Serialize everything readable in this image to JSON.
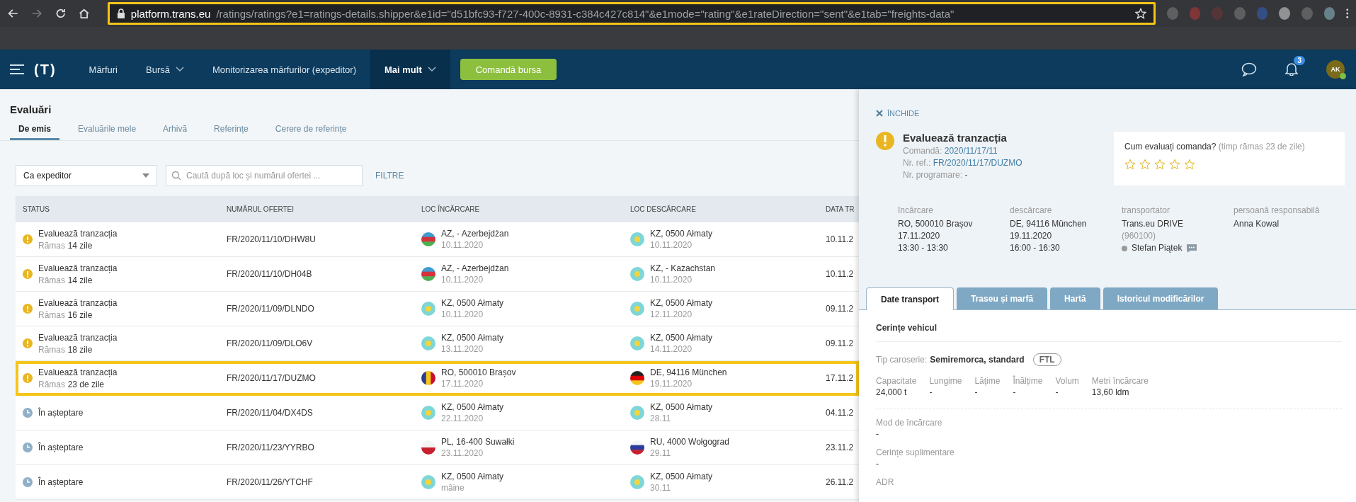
{
  "browser": {
    "url_domain": "platform.trans.eu",
    "url_path": "/ratings/ratings?e1=ratings-details.shipper&e1id=\"d51bfc93-f727-400c-8931-c384c427c814\"&e1mode=\"rating\"&e1rateDirection=\"sent\"&e1tab=\"freights-data\""
  },
  "nav": {
    "logo": "(T)",
    "items": [
      {
        "label": "Mărfuri",
        "dropdown": false,
        "selected": false
      },
      {
        "label": "Bursă",
        "dropdown": true,
        "selected": false
      },
      {
        "label": "Monitorizarea mărfurilor (expeditor)",
        "dropdown": false,
        "selected": false
      },
      {
        "label": "Mai mult",
        "dropdown": true,
        "selected": true
      }
    ],
    "cta": "Comandă bursa",
    "notifications": "3",
    "avatar": "AK"
  },
  "page": {
    "title": "Evaluări",
    "tabs": [
      {
        "label": "De emis",
        "selected": true
      },
      {
        "label": "Evaluările mele",
        "selected": false
      },
      {
        "label": "Arhivă",
        "selected": false
      },
      {
        "label": "Referințe",
        "selected": false
      },
      {
        "label": "Cerere de referințe",
        "selected": false
      }
    ]
  },
  "filters": {
    "role": "Ca expeditor",
    "search_placeholder": "Caută după loc și numărul ofertei ...",
    "filters_link": "FILTRE"
  },
  "table": {
    "columns": [
      "STATUS",
      "NUMĂRUL OFERTEI",
      "LOC ÎNCĂRCARE",
      "LOC DESCĂRCARE",
      "DATA TR"
    ],
    "rows": [
      {
        "kind": "rate",
        "status": "Evaluează tranzacția",
        "remaining_label": "Rămas",
        "remaining": "14 zile",
        "offer": "FR/2020/11/10/DHW8U",
        "load": {
          "kind": "az",
          "place": "AZ, - Azerbejdżan",
          "date": "10.11.2020"
        },
        "unload": {
          "kind": "kz",
          "place": "KZ, 0500 Ałmaty",
          "date": "10.11.2020"
        },
        "date": "10.11.2",
        "selected": false
      },
      {
        "kind": "rate",
        "status": "Evaluează tranzacția",
        "remaining_label": "Rămas",
        "remaining": "14 zile",
        "offer": "FR/2020/11/10/DH04B",
        "load": {
          "kind": "az",
          "place": "AZ, - Azerbejdżan",
          "date": "10.11.2020"
        },
        "unload": {
          "kind": "kz",
          "place": "KZ, - Kazachstan",
          "date": "10.11.2020"
        },
        "date": "10.11.2",
        "selected": false
      },
      {
        "kind": "rate",
        "status": "Evaluează tranzacția",
        "remaining_label": "Rămas",
        "remaining": "16 zile",
        "offer": "FR/2020/11/09/DLNDO",
        "load": {
          "kind": "kz",
          "place": "KZ, 0500 Ałmaty",
          "date": "10.11.2020"
        },
        "unload": {
          "kind": "kz",
          "place": "KZ, 0500 Ałmaty",
          "date": "12.11.2020"
        },
        "date": "09.11.2",
        "selected": false
      },
      {
        "kind": "rate",
        "status": "Evaluează tranzacția",
        "remaining_label": "Rămas",
        "remaining": "18 zile",
        "offer": "FR/2020/11/09/DLO6V",
        "load": {
          "kind": "kz",
          "place": "KZ, 0500 Ałmaty",
          "date": "13.11.2020"
        },
        "unload": {
          "kind": "kz",
          "place": "KZ, 0500 Ałmaty",
          "date": "14.11.2020"
        },
        "date": "09.11.2",
        "selected": false
      },
      {
        "kind": "rate",
        "status": "Evaluează tranzacția",
        "remaining_label": "Rămas",
        "remaining": "23 de zile",
        "offer": "FR/2020/11/17/DUZMO",
        "load": {
          "kind": "ro",
          "place": "RO, 500010 Brașov",
          "date": "17.11.2020"
        },
        "unload": {
          "kind": "de",
          "place": "DE, 94116 München",
          "date": "19.11.2020"
        },
        "date": "17.11.2",
        "selected": true
      },
      {
        "kind": "waiting",
        "status": "În așteptare",
        "offer": "FR/2020/11/04/DX4DS",
        "load": {
          "kind": "kz",
          "place": "KZ, 0500 Ałmaty",
          "date": "22.11.2020"
        },
        "unload": {
          "kind": "kz",
          "place": "KZ, 0500 Ałmaty",
          "date": "28.11"
        },
        "date": "04.11.2",
        "selected": false
      },
      {
        "kind": "waiting",
        "status": "În așteptare",
        "offer": "FR/2020/11/23/YYRBO",
        "load": {
          "kind": "pl",
          "place": "PL, 16-400 Suwałki",
          "date": "23.11.2020"
        },
        "unload": {
          "kind": "ru",
          "place": "RU, 4000 Wołgograd",
          "date": "29.11"
        },
        "date": "23.11.2",
        "selected": false
      },
      {
        "kind": "waiting",
        "status": "În așteptare",
        "offer": "FR/2020/11/26/YTCHF",
        "load": {
          "kind": "kz",
          "place": "KZ, 0500 Ałmaty",
          "date": "mâine"
        },
        "unload": {
          "kind": "kz",
          "place": "KZ, 0500 Ałmaty",
          "date": "30.11"
        },
        "date": "26.11.2",
        "selected": false
      }
    ]
  },
  "panel": {
    "close": "ÎNCHIDE",
    "title": "Evaluează tranzacția",
    "refs": [
      {
        "label": "Comandă:",
        "value": "2020/11/17/11",
        "link": true
      },
      {
        "label": "Nr. ref.:",
        "value": "FR/2020/11/17/DUZMO",
        "link": true
      },
      {
        "label": "Nr. programare:",
        "value": "-",
        "link": false
      }
    ],
    "rating": {
      "question": "Cum evaluați comanda?",
      "hint": "(timp rămas 23 de zile)",
      "stars": 0
    },
    "details": [
      {
        "label": "încărcare",
        "lines": [
          {
            "kind": "text",
            "text": "RO, 500010 Brașov"
          },
          {
            "kind": "text",
            "text": "17.11.2020"
          },
          {
            "kind": "text",
            "text": "13:30 - 13:30"
          }
        ]
      },
      {
        "label": "descărcare",
        "lines": [
          {
            "kind": "text",
            "text": "DE, 94116 München"
          },
          {
            "kind": "text",
            "text": "19.11.2020"
          },
          {
            "kind": "text",
            "text": "16:00 - 16:30"
          }
        ]
      },
      {
        "label": "transportator",
        "lines": [
          {
            "kind": "text",
            "text": "Trans.eu DRIVE"
          },
          {
            "kind": "muted",
            "text": "(960100)"
          },
          {
            "kind": "person",
            "text": "Stefan Piątek"
          }
        ]
      },
      {
        "label": "persoană responsabilă",
        "lines": [
          {
            "kind": "text",
            "text": "Anna Kowal"
          }
        ]
      }
    ],
    "tabs": [
      {
        "label": "Date transport",
        "selected": true
      },
      {
        "label": "Traseu și marfă",
        "selected": false
      },
      {
        "label": "Hartă",
        "selected": false
      },
      {
        "label": "Istoricul modificărilor",
        "selected": false
      }
    ],
    "section": "Cerințe vehicul",
    "body_type": {
      "label": "Tip caroserie:",
      "value": "Semiremorca, standard",
      "tag": "FTL"
    },
    "specs": [
      {
        "label": "Capacitate",
        "value": "24,000 t"
      },
      {
        "label": "Lungime",
        "value": "-"
      },
      {
        "label": "Lățime",
        "value": "-"
      },
      {
        "label": "Înălțime",
        "value": "-"
      },
      {
        "label": "Volum",
        "value": "-"
      },
      {
        "label": "Metri încărcare",
        "value": "13,60 ldm"
      }
    ],
    "fields": [
      {
        "label": "Mod de încărcare",
        "value": "-"
      },
      {
        "label": "Cerințe suplimentare",
        "value": "-"
      },
      {
        "label": "ADR"
      }
    ]
  }
}
